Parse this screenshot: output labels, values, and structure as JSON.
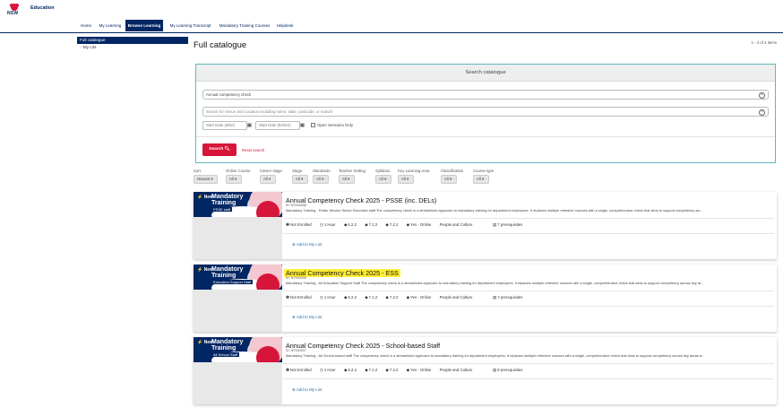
{
  "brand": {
    "logo_text": "NSW",
    "org": "Education",
    "accent": "#002664",
    "red": "#d7153a"
  },
  "nav": [
    {
      "label": "Home"
    },
    {
      "label": "My Learning"
    },
    {
      "label": "Browse Learning"
    },
    {
      "label": "My Learning Transcript"
    },
    {
      "label": "Mandatory Training Courses"
    },
    {
      "label": "Helpdesk"
    }
  ],
  "sidebar": {
    "full_catalogue": "Full catalogue",
    "my_list": "- My List"
  },
  "page": {
    "title": "Full catalogue",
    "results": "1 - 4 of 4 items"
  },
  "search": {
    "header": "Search catalogue",
    "keyword_value": "Annual competency check",
    "location_placeholder": "Search for Venue and Location including name, state, postcode, or suburb",
    "start_after": "Start Date (after)",
    "start_before": "Start Date (before)",
    "open_sessions": "Open Sessions Only",
    "search_label": "Search",
    "reset_label": "Reset search"
  },
  "filters": [
    {
      "label": "Sort",
      "value": "Newest ▾"
    },
    {
      "label": "Online Course",
      "value": "All ▾"
    },
    {
      "label": "Career stage",
      "value": "All ▾"
    },
    {
      "label": "Stage",
      "value": "All ▾"
    },
    {
      "label": "Standards",
      "value": "All ▾"
    },
    {
      "label": "Teacher Setting",
      "value": "All ▾"
    },
    {
      "label": "Syllabus",
      "value": "All ▾"
    },
    {
      "label": "Key Learning Area",
      "value": "All ▾"
    },
    {
      "label": "Classification",
      "value": "All ▾"
    },
    {
      "label": "Course type",
      "value": "All ▾"
    }
  ],
  "courses": [
    {
      "thumb_new": "New",
      "thumb_line1": "Mandatory",
      "thumb_line2": "Training",
      "thumb_line3": "PSSE staff",
      "title": "Annual Competency Check 2025 - PSSE (inc. DELs)",
      "id": "ID: NTS00006",
      "description": "Mandatory Training - Public Service Senior Executive staff The competency check is a streamlined approach to mandatory training for department employees. It replaces multiple refresher courses with a single, comprehensive check that aims to support competency acr...",
      "status": "Not Enrolled",
      "duration": "1 Hour",
      "tag1": "6.2.2",
      "tag2": "7.1.2",
      "tag3": "7.2.2",
      "tag4": "Yes - Online",
      "tag5": "People and Culture",
      "prereq": "7 prerequisites",
      "add_label": "Add to My List",
      "highlight": false
    },
    {
      "thumb_new": "New",
      "thumb_line1": "Mandatory",
      "thumb_line2": "Training",
      "thumb_line3": "Education Support Staff",
      "title": "Annual Competency Check 2025 - ESS",
      "id": "ID: NTS00005",
      "description": "Mandatory Training - All Education Support Staff The competency check is a streamlined approach to mandatory training for department employees. It replaces multiple refresher courses with a single, comprehensive check that aims to support competency across key ar...",
      "status": "Not Enrolled",
      "duration": "1 Hour",
      "tag1": "6.2.2",
      "tag2": "7.1.2",
      "tag3": "7.2.2",
      "tag4": "Yes - Online",
      "tag5": "People and Culture",
      "prereq": "7 prerequisites",
      "add_label": "Add to My List",
      "highlight": true
    },
    {
      "thumb_new": "New",
      "thumb_line1": "Mandatory",
      "thumb_line2": "Training",
      "thumb_line3": "All School Staff",
      "title": "Annual Competency Check 2025 - School-based Staff",
      "id": "ID: NTS00007",
      "description": "Mandatory Training - All School-based staff The competency check is a streamlined approach to mandatory training for department employees. It replaces multiple refresher courses with a single, comprehensive check that aims to support competency across key areas w...",
      "status": "Not Enrolled",
      "duration": "1 Hour",
      "tag1": "6.2.2",
      "tag2": "7.1.2",
      "tag3": "7.2.2",
      "tag4": "Yes - Online",
      "tag5": "People and Culture",
      "prereq": "8 prerequisites",
      "add_label": "Add to My List",
      "highlight": false
    }
  ]
}
